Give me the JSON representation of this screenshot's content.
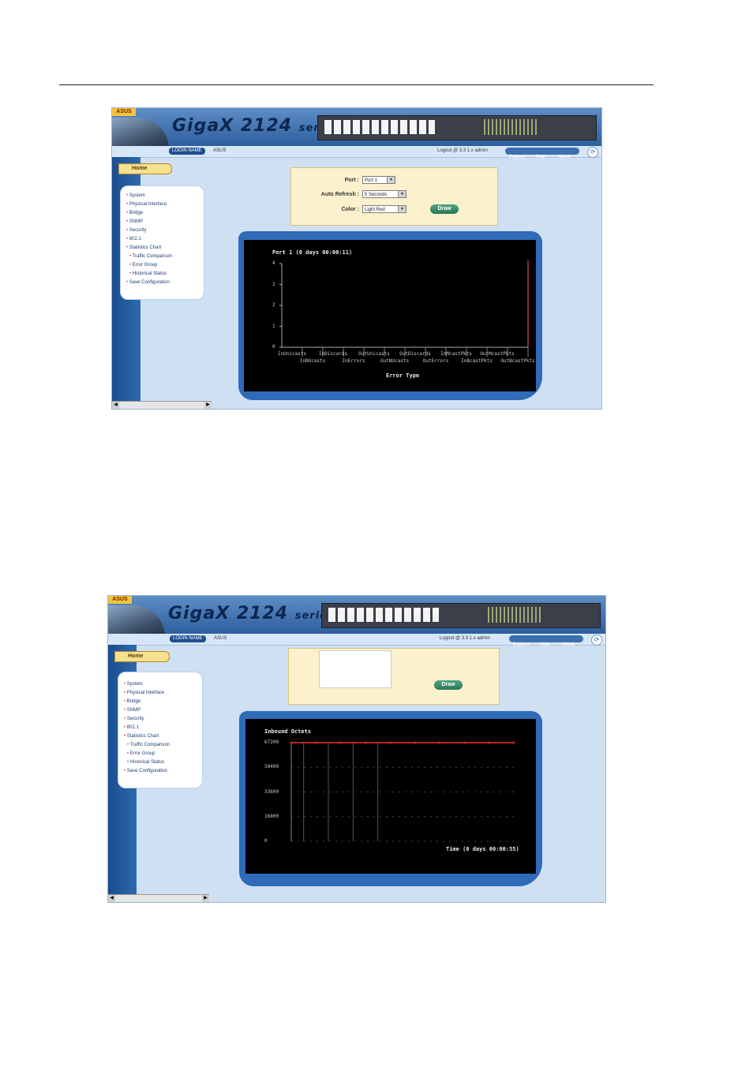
{
  "shot1": {
    "brand": {
      "name": "GigaX",
      "model": "2124",
      "series": "series",
      "badge": "ASUS"
    },
    "subbar": {
      "ip_pill": "LOGIN NAME",
      "user": "ASUS",
      "status": "Logout @ 3.3 1.x admin",
      "nav": [
        "Support",
        "Help",
        "About"
      ]
    },
    "home_label": "Home",
    "menu": [
      {
        "label": "System",
        "sub": false
      },
      {
        "label": "Physical Interface",
        "sub": false
      },
      {
        "label": "Bridge",
        "sub": false
      },
      {
        "label": "SNMP",
        "sub": false
      },
      {
        "label": "Security",
        "sub": false
      },
      {
        "label": "802.1",
        "sub": false
      },
      {
        "label": "Statistics Chart",
        "sub": false
      },
      {
        "label": "Traffic Comparison",
        "sub": true
      },
      {
        "label": "Error Group",
        "sub": true
      },
      {
        "label": "Historical Status",
        "sub": true
      },
      {
        "label": "Save Configuration",
        "sub": false
      }
    ],
    "form": {
      "port_label": "Port :",
      "port_value": "Port 1",
      "refresh_label": "Auto Refresh :",
      "refresh_value": "5 Seconds",
      "color_label": "Color :",
      "color_value": "Light Red",
      "draw_button": "Draw"
    },
    "chart_data": {
      "type": "bar",
      "title": "Port 1 (0 days 00:00:11)",
      "xlabel": "Error Type",
      "ylabel": "",
      "ylim": [
        0,
        4
      ],
      "yticks": [
        "4",
        "3",
        "2",
        "1",
        "0"
      ],
      "categories": [
        "InUnicasts",
        "InNUcasts",
        "InDiscards",
        "InErrors",
        "OutUnicasts",
        "OutNUcasts",
        "OutDiscards",
        "OutErrors",
        "InMcastPkts",
        "InBcastPkts",
        "OutMcastPkts",
        "OutBcastPkts"
      ],
      "values": [
        0,
        0,
        0,
        0,
        0,
        0,
        0,
        0,
        0,
        0,
        0,
        0
      ],
      "series_color": "#ff4a4a"
    }
  },
  "shot2": {
    "brand": {
      "name": "GigaX",
      "model": "2124",
      "series": "series",
      "badge": "ASUS"
    },
    "subbar": {
      "ip_pill": "LOGIN NAME",
      "user": "ASUS",
      "status": "Logout @ 3.3 1.x admin",
      "nav": [
        "Support",
        "Help",
        "About"
      ]
    },
    "home_label": "Home",
    "menu": [
      {
        "label": "System",
        "sub": false
      },
      {
        "label": "Physical Interface",
        "sub": false
      },
      {
        "label": "Bridge",
        "sub": false
      },
      {
        "label": "SNMP",
        "sub": false
      },
      {
        "label": "Security",
        "sub": false
      },
      {
        "label": "802.1",
        "sub": false
      },
      {
        "label": "Statistics Chart",
        "sub": false
      },
      {
        "label": "Traffic Comparison",
        "sub": true
      },
      {
        "label": "Error Group",
        "sub": true
      },
      {
        "label": "Historical Status",
        "sub": true
      },
      {
        "label": "Save Configuration",
        "sub": false
      }
    ],
    "form": {
      "draw_button": "Draw"
    },
    "chart_data": {
      "type": "line",
      "title": "Inbound Octets",
      "xlabel": "Time (0 days 00:00:55)",
      "ylabel": "",
      "ylim": [
        0,
        67200
      ],
      "yticks": [
        "67200",
        "50400",
        "33600",
        "16800",
        "0"
      ],
      "x": [
        0,
        1,
        2,
        3,
        4,
        5,
        6,
        7,
        8,
        9
      ],
      "values": [
        67200,
        67200,
        67200,
        67200,
        67200,
        67200,
        67200,
        67200,
        67200,
        67200
      ],
      "series_color": "#ff3030"
    }
  }
}
